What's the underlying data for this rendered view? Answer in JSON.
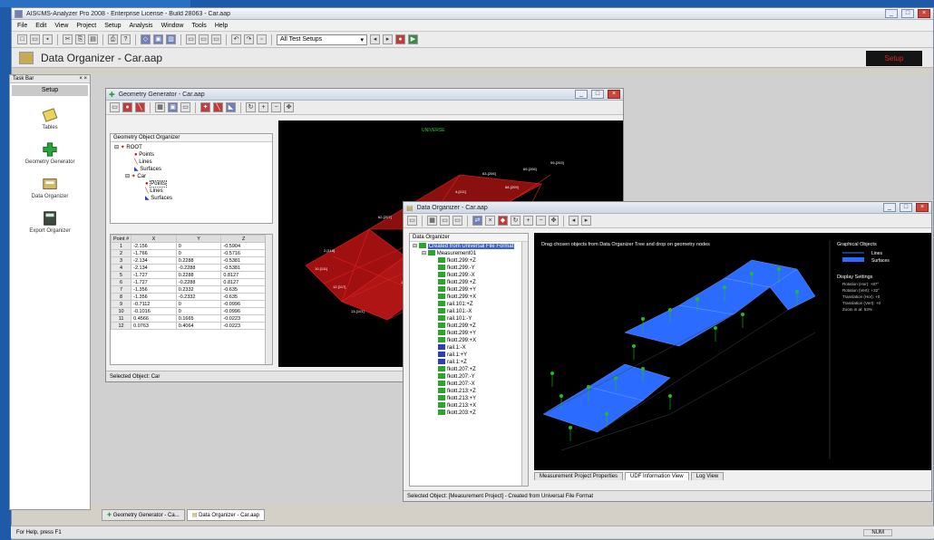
{
  "app": {
    "title": "AIS©MS-Analyzer Pro 2008 - Enterprise License - Build 28063 - Car.aap",
    "menus": [
      "File",
      "Edit",
      "View",
      "Project",
      "Setup",
      "Analysis",
      "Window",
      "Tools",
      "Help"
    ],
    "toolbar_combo": "All Test Setups",
    "banner_title": "Data Organizer - Car.aap",
    "setup_button": "Setup",
    "status_left": "For Help, press F1",
    "status_right": "NUM"
  },
  "left_pane": {
    "header": "Task Bar",
    "setup_label": "Setup",
    "items": [
      {
        "label": "Tables"
      },
      {
        "label": "Geometry Generator"
      },
      {
        "label": "Data Organizer"
      },
      {
        "label": "Export Organizer"
      }
    ]
  },
  "geometry_window": {
    "title": "Geometry Generator - Car.aap",
    "tree_header": "Geometry Object Organizer",
    "tree": [
      {
        "label": "ROOT",
        "level": 0
      },
      {
        "label": "Points",
        "level": 1
      },
      {
        "label": "Lines",
        "level": 1
      },
      {
        "label": "Surfaces",
        "level": 1
      },
      {
        "label": "Car",
        "level": 1
      },
      {
        "label": "Points",
        "level": 2
      },
      {
        "label": "Lines",
        "level": 2
      },
      {
        "label": "Surfaces",
        "level": 2
      }
    ],
    "table": {
      "headers": [
        "Point #",
        "X",
        "Y",
        "Z"
      ],
      "rows": [
        [
          "1",
          "-2.156",
          "0",
          "-0.5904"
        ],
        [
          "2",
          "-1.766",
          "0",
          "-0.5716"
        ],
        [
          "3",
          "-2.134",
          "0.2288",
          "-0.5381"
        ],
        [
          "4",
          "-2.134",
          "-0.2288",
          "-0.5381"
        ],
        [
          "5",
          "-1.727",
          "0.2288",
          "0.8127"
        ],
        [
          "6",
          "-1.727",
          "-0.2288",
          "0.8127"
        ],
        [
          "7",
          "-1.356",
          "0.2332",
          "-0.635"
        ],
        [
          "8",
          "-1.356",
          "-0.2332",
          "-0.635"
        ],
        [
          "9",
          "-0.7112",
          "0",
          "-0.0996"
        ],
        [
          "10",
          "-0.1016",
          "0",
          "-0.0996"
        ],
        [
          "11",
          "0.4566",
          "0.1665",
          "-0.0223"
        ],
        [
          "12",
          "0.0763",
          "0.4064",
          "-0.0223"
        ]
      ]
    },
    "status": "Selected Object: Car",
    "canvas_label": "UNIVERSE"
  },
  "data_window": {
    "title": "Data Organizer - Car.aap",
    "tree_header": "Data Organizer",
    "root_item": "Created from Universal File Format",
    "measurement": "Measurement01",
    "items": [
      "fkott.299:+Z",
      "fkott.299:-Y",
      "fkott.299:-X",
      "fkott.299:+Z",
      "fkott.299:+Y",
      "fkott.299:+X",
      "rail.101:+Z",
      "rail.101:-X",
      "rail.101:-Y",
      "fkott.299:+Z",
      "fkott.299:+Y",
      "fkott.299:+X",
      "rail.1:-X",
      "rail.1:+Y",
      "rail.1:+Z",
      "fkott.207:+Z",
      "fkott.207:-Y",
      "fkott.207:-X",
      "fkott.213:+Z",
      "fkott.213:+Y",
      "fkott.213:+X",
      "fkott.203:+Z"
    ],
    "canvas_heading": "Drag chosen objects from Data Organizer Tree and drop on geometry nodes",
    "legend_title": "Graphical Objects",
    "legend_lines": "Lines",
    "legend_surfaces": "Surfaces",
    "display_title": "Display Settings",
    "display_settings": [
      "Rotation (Hor): +87°",
      "Rotation (Vert): +32°",
      "Translation (Hor): +0",
      "Translation (Vert): +0",
      "Zoom in at: 53%"
    ],
    "tabs": [
      "Measurement Project Properties",
      "UDF Information View",
      "Log View"
    ],
    "status": "Selected Object: [Measurement Project] - Created from Universal File Format"
  },
  "taskbar_tabs": [
    "Geometry Generator - Ca...",
    "Data Organizer - Car.aap"
  ],
  "colors": {
    "desktop": "#1e5aa8",
    "red_geometry": "#cc1111",
    "blue_surface": "#2b6bff",
    "green_node": "#1fbf1f"
  }
}
